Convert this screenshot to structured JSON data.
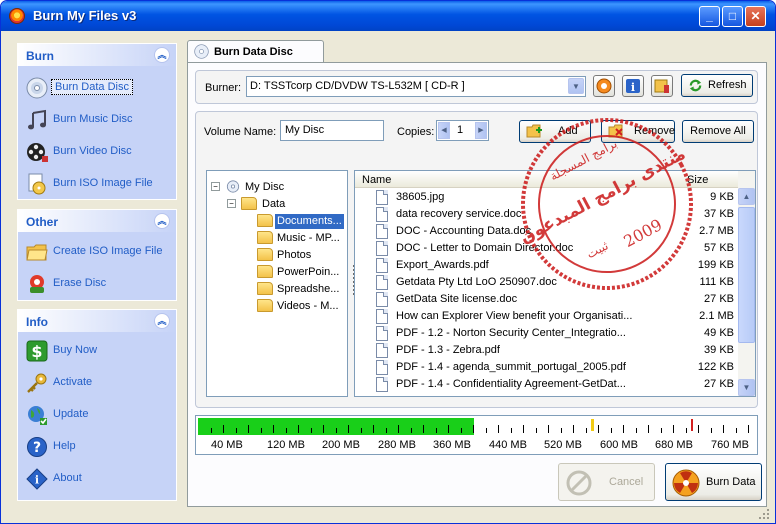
{
  "window": {
    "title": "Burn My Files v3"
  },
  "sidebar": {
    "burn": {
      "title": "Burn",
      "items": [
        {
          "label": "Burn Data Disc",
          "icon": "data-disc-icon"
        },
        {
          "label": "Burn Music Disc",
          "icon": "music-notes-icon"
        },
        {
          "label": "Burn Video Disc",
          "icon": "film-reel-icon"
        },
        {
          "label": "Burn ISO Image File",
          "icon": "iso-file-icon"
        }
      ]
    },
    "other": {
      "title": "Other",
      "items": [
        {
          "label": "Create ISO Image File",
          "icon": "folder-icon"
        },
        {
          "label": "Erase Disc",
          "icon": "erase-disc-icon"
        }
      ]
    },
    "info": {
      "title": "Info",
      "items": [
        {
          "label": "Buy Now",
          "icon": "dollar-icon"
        },
        {
          "label": "Activate",
          "icon": "key-icon"
        },
        {
          "label": "Update",
          "icon": "globe-icon"
        },
        {
          "label": "Help",
          "icon": "help-icon"
        },
        {
          "label": "About",
          "icon": "info-icon"
        }
      ]
    }
  },
  "tab": {
    "label": "Burn Data Disc"
  },
  "burner": {
    "label": "Burner:",
    "value": "D: TSSTcorp CD/DVDW TS-L532M [ CD-R ]",
    "refresh_label": "Refresh"
  },
  "volume": {
    "label": "Volume Name:",
    "value": "My Disc"
  },
  "copies": {
    "label": "Copies:",
    "value": "1"
  },
  "actions": {
    "add": "Add",
    "remove": "Remove",
    "remove_all": "Remove All"
  },
  "tree": {
    "root": "My Disc",
    "data": "Data",
    "folders": [
      "Documents...",
      "Music - MP...",
      "Photos",
      "PowerPoin...",
      "Spreadshe...",
      "Videos - M..."
    ]
  },
  "list": {
    "columns": {
      "name": "Name",
      "size": "Size"
    },
    "rows": [
      {
        "name": "38605.jpg",
        "size": "9 KB"
      },
      {
        "name": "data recovery service.doc",
        "size": "37 KB"
      },
      {
        "name": "DOC - Accounting Data.doc",
        "size": "2.7 MB"
      },
      {
        "name": "DOC - Letter to Domain Director.doc",
        "size": "57 KB"
      },
      {
        "name": "Export_Awards.pdf",
        "size": "199 KB"
      },
      {
        "name": "Getdata Pty Ltd LoO 250907.doc",
        "size": "111 KB"
      },
      {
        "name": "GetData Site license.doc",
        "size": "27 KB"
      },
      {
        "name": "How can Explorer View benefit your Organisati...",
        "size": "2.1 MB"
      },
      {
        "name": "PDF - 1.2 - Norton Security Center_Integratio...",
        "size": "49 KB"
      },
      {
        "name": "PDF - 1.3 - Zebra.pdf",
        "size": "39 KB"
      },
      {
        "name": "PDF - 1.4 - agenda_summit_portugal_2005.pdf",
        "size": "122 KB"
      },
      {
        "name": "PDF - 1.4 - Confidentiality Agreement-GetDat...",
        "size": "27 KB"
      }
    ]
  },
  "capacity": {
    "labels": [
      "40 MB",
      "120 MB",
      "200 MB",
      "280 MB",
      "360 MB",
      "440 MB",
      "520 MB",
      "600 MB",
      "680 MB",
      "760 MB"
    ],
    "used_fraction": 0.495,
    "fill_color": "#19cf19"
  },
  "buttons": {
    "cancel": "Cancel",
    "burn": "Burn Data"
  },
  "watermark": {
    "line1": "منتدى برامج المبدعون",
    "line2": "برامج المسجلة",
    "year": "2009",
    "sign": "ثبيت"
  }
}
